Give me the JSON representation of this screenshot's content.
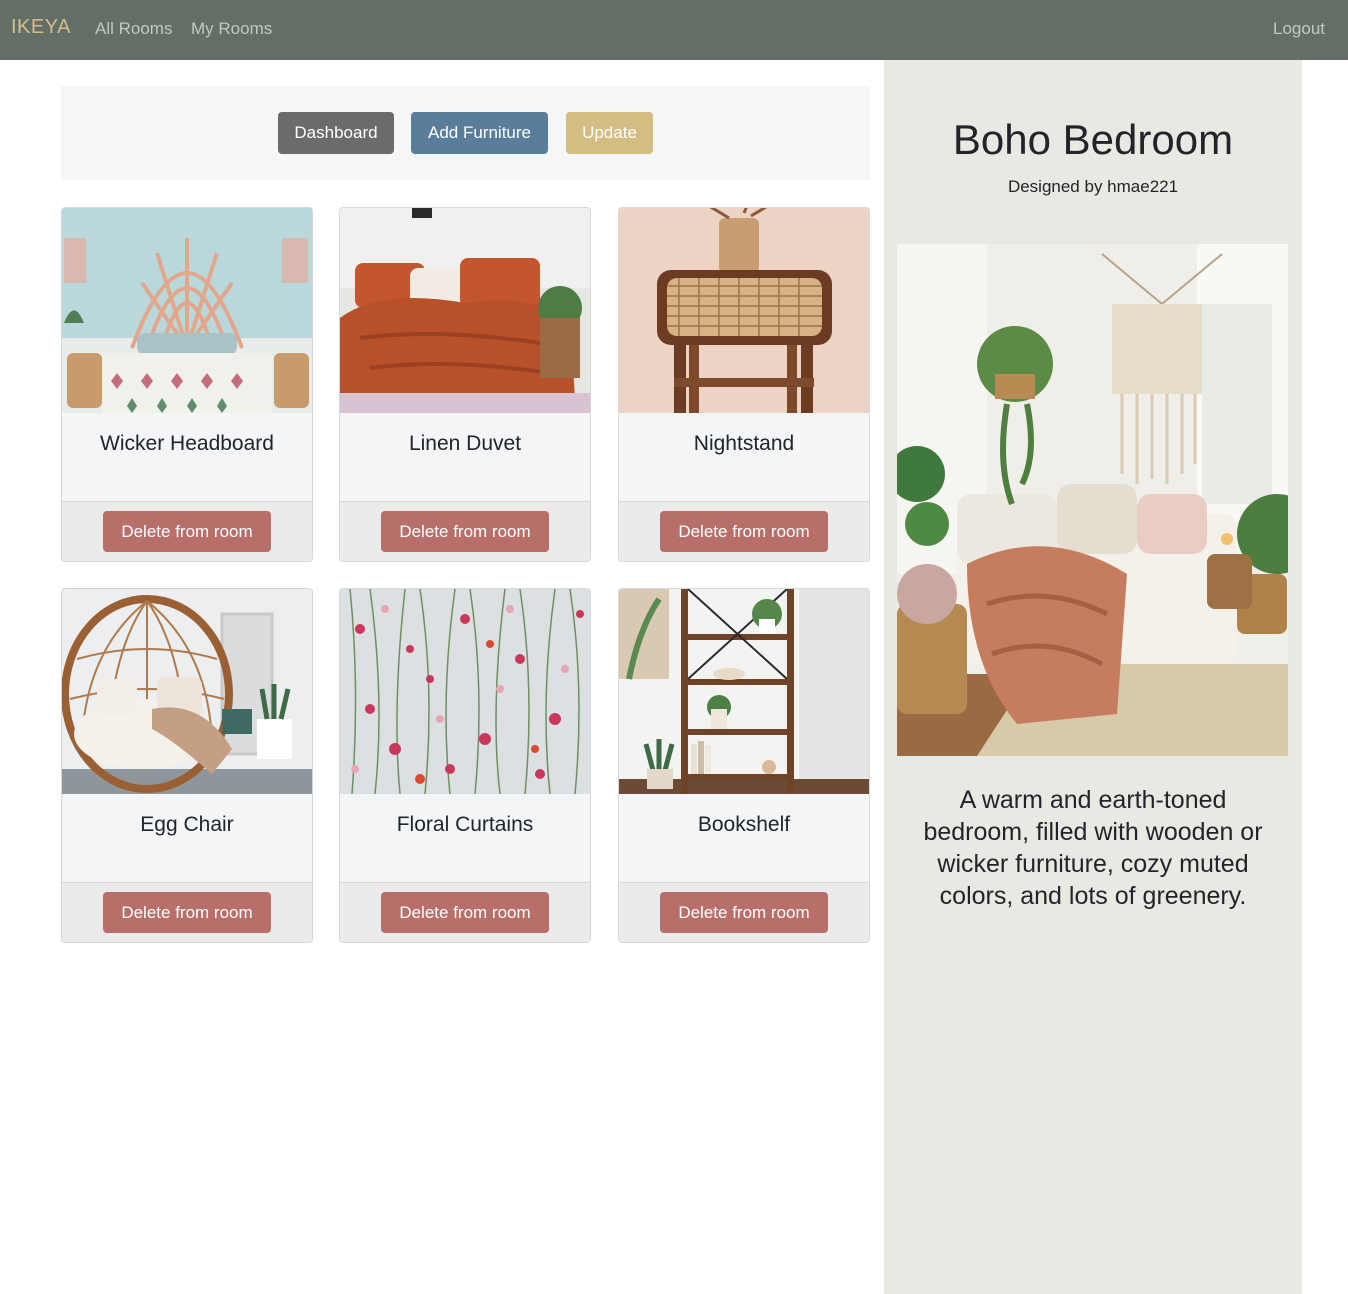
{
  "nav": {
    "brand": "IKEYA",
    "links": [
      "All Rooms",
      "My Rooms"
    ],
    "logout": "Logout"
  },
  "toolbar": {
    "dashboard": "Dashboard",
    "add_furniture": "Add Furniture",
    "update": "Update"
  },
  "furniture": [
    {
      "name": "Wicker Headboard",
      "action": "Delete from room"
    },
    {
      "name": "Linen Duvet",
      "action": "Delete from room"
    },
    {
      "name": "Nightstand",
      "action": "Delete from room"
    },
    {
      "name": "Egg Chair",
      "action": "Delete from room"
    },
    {
      "name": "Floral Curtains",
      "action": "Delete from room"
    },
    {
      "name": "Bookshelf",
      "action": "Delete from room"
    }
  ],
  "room": {
    "title": "Boho Bedroom",
    "designer": "Designed by hmae221",
    "description": "A warm and earth-toned bedroom, filled with wooden or wicker furniture, cozy muted colors, and lots of greenery."
  },
  "colors": {
    "navbar": "#626e66",
    "brand": "#d7bd8b",
    "dashboard_button": "#6b6b6b",
    "add_button": "#5a7d9c",
    "update_button": "#d4bd82",
    "delete_button": "#b86f6a",
    "sidebar": "#e9e9e4"
  }
}
